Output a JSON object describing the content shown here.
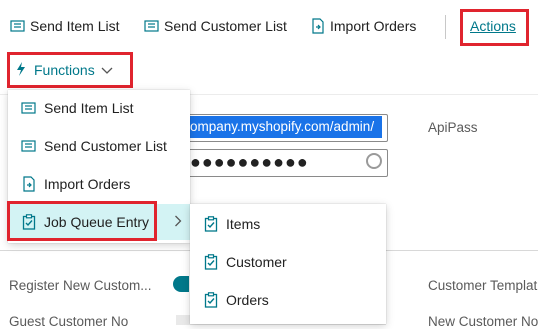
{
  "toolbar": {
    "send_item_list": "Send Item List",
    "send_customer_list": "Send Customer List",
    "import_orders": "Import Orders",
    "actions": "Actions"
  },
  "subbar": {
    "functions": "Functions"
  },
  "form": {
    "url_value": "ompany.myshopify.com/admin/",
    "password_mask": "●●●●●●●●●●",
    "api_pass_label": "ApiPass",
    "register_new_customer_label": "Register New Custom...",
    "customer_template_label": "Customer Templat",
    "guest_customer_label": "Guest Customer No",
    "new_customer_label": "New Customer No"
  },
  "functions_menu": {
    "items": [
      {
        "label": "Send Item List",
        "icon": "list-send-icon"
      },
      {
        "label": "Send Customer List",
        "icon": "list-send-icon"
      },
      {
        "label": "Import Orders",
        "icon": "document-import-icon"
      },
      {
        "label": "Job Queue Entry",
        "icon": "clipboard-check-icon"
      }
    ]
  },
  "job_queue_menu": {
    "items": [
      {
        "label": "Items",
        "icon": "clipboard-check-icon"
      },
      {
        "label": "Customer",
        "icon": "clipboard-check-icon"
      },
      {
        "label": "Orders",
        "icon": "clipboard-check-icon"
      }
    ]
  },
  "colors": {
    "accent": "#00788a",
    "highlight": "#d3f3f4",
    "annotation_red": "#e0242e",
    "selection_blue": "#1a73e8"
  }
}
